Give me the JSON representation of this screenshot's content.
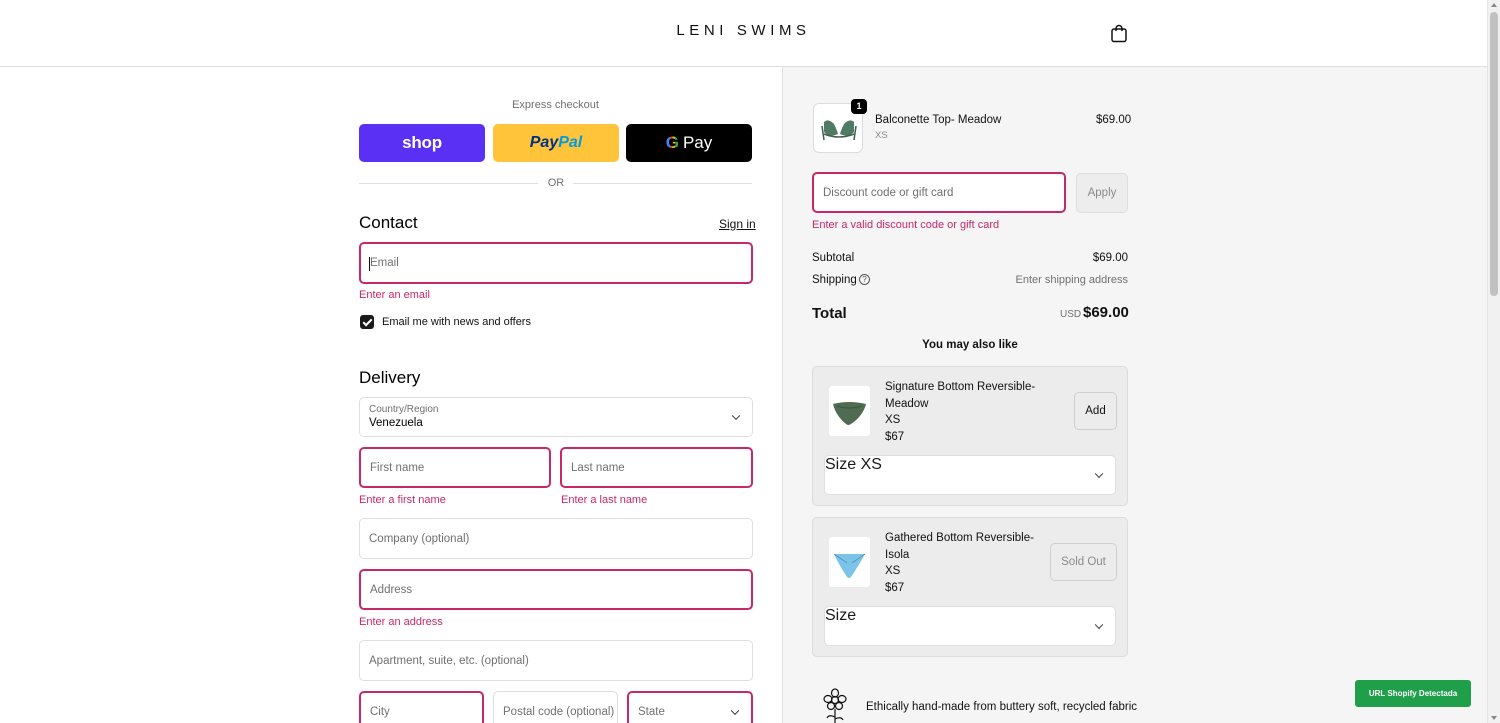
{
  "header": {
    "brand": "LENI SWIMS",
    "cart_icon": "shopping-bag-icon"
  },
  "express": {
    "label": "Express checkout",
    "shop_label": "shop",
    "paypal_pay": "Pay",
    "paypal_pal": "Pal",
    "gpay_g": "G",
    "gpay_label": "Pay",
    "or_label": "OR"
  },
  "contact": {
    "title": "Contact",
    "sign_in": "Sign in",
    "email_placeholder": "Email",
    "email_error": "Enter an email",
    "newsletter_label": "Email me with news and offers",
    "newsletter_checked": true
  },
  "delivery": {
    "title": "Delivery",
    "country_label": "Country/Region",
    "country_value": "Venezuela",
    "first_name_placeholder": "First name",
    "first_name_error": "Enter a first name",
    "last_name_placeholder": "Last name",
    "last_name_error": "Enter a last name",
    "company_placeholder": "Company (optional)",
    "address_placeholder": "Address",
    "address_error": "Enter an address",
    "apartment_placeholder": "Apartment, suite, etc. (optional)",
    "city_placeholder": "City",
    "postal_placeholder": "Postal code (optional)",
    "state_placeholder": "State"
  },
  "order": {
    "item": {
      "name": "Balconette Top- Meadow",
      "variant": "XS",
      "price": "$69.00",
      "quantity": "1"
    },
    "discount_placeholder": "Discount code or gift card",
    "apply_label": "Apply",
    "discount_error": "Enter a valid discount code or gift card",
    "subtotal_label": "Subtotal",
    "subtotal_value": "$69.00",
    "shipping_label": "Shipping",
    "shipping_help": "?",
    "shipping_value": "Enter shipping address",
    "total_label": "Total",
    "total_currency": "USD",
    "total_value": "$69.00"
  },
  "recommendations": {
    "title": "You may also like",
    "items": [
      {
        "name": "Signature Bottom Reversible-Meadow",
        "size": "XS",
        "price": "$67",
        "button": "Add",
        "size_label": "Size",
        "size_value": "XS"
      },
      {
        "name": "Gathered Bottom Reversible-Isola",
        "size": "XS",
        "price": "$67",
        "button": "Sold Out",
        "size_label": "Size",
        "size_value": ""
      }
    ]
  },
  "footer_note": "Ethically hand-made from buttery soft, recycled fabric",
  "extension_badge": "URL Shopify Detectada",
  "colors": {
    "error": "#c7286a",
    "shop_pay": "#5a31f4",
    "paypal": "#ffc439",
    "gpay": "#000000",
    "panel": "#f5f5f5",
    "badge": "#1f9f4a"
  }
}
